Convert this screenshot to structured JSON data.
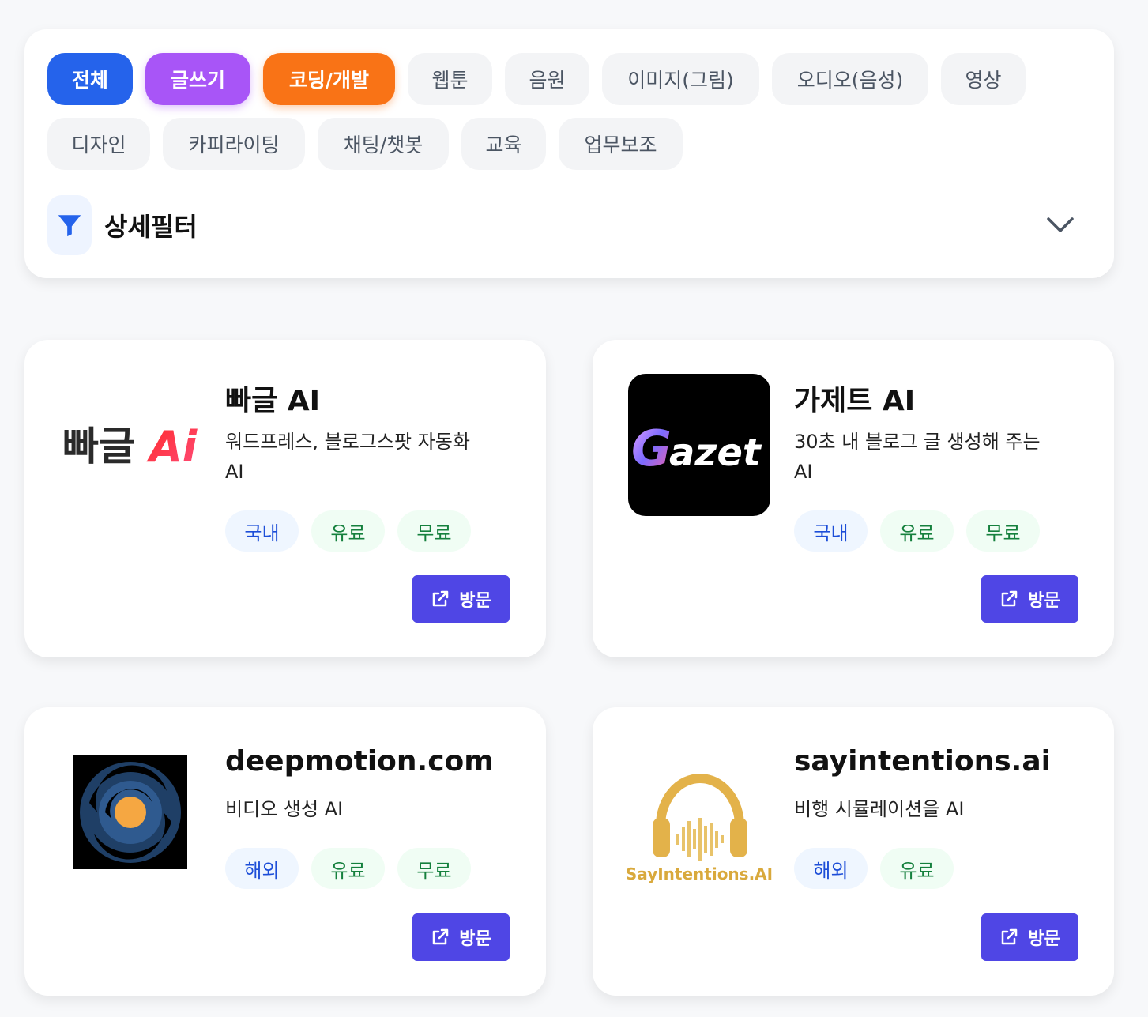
{
  "categories": {
    "row1": [
      "전체",
      "글쓰기",
      "코딩/개발",
      "웹툰",
      "음원",
      "이미지(그림)",
      "오디오(음성)",
      "영상"
    ],
    "row2": [
      "디자인",
      "카피라이팅",
      "채팅/챗봇",
      "교육",
      "업무보조"
    ]
  },
  "filter": {
    "label": "상세필터"
  },
  "cards": [
    {
      "title": "빠글 AI",
      "desc_line1": "워드프레스, 블로그스팟 자동화",
      "desc_line2": "AI",
      "logo_text_main": "빠글",
      "logo_text_ai": "Ai",
      "tags": [
        "국내",
        "유료",
        "무료"
      ],
      "visit_label": "방문"
    },
    {
      "title": "가제트 AI",
      "desc_line1": "30초 내 블로그 글 생성해 주는",
      "desc_line2": "AI",
      "logo_text_g": "G",
      "logo_text_rest": "azet",
      "tags": [
        "국내",
        "유료",
        "무료"
      ],
      "visit_label": "방문"
    },
    {
      "title": "deepmotion.com",
      "desc_line1": "비디오 생성 AI",
      "tags": [
        "해외",
        "유료",
        "무료"
      ],
      "visit_label": "방문"
    },
    {
      "title": "sayintentions.ai",
      "desc_line1": "비행 시뮬레이션을 AI",
      "logo_text": "SayIntentions.AI",
      "tags": [
        "해외",
        "유료"
      ],
      "visit_label": "방문"
    }
  ],
  "colors": {
    "accent_blue": "#2563eb",
    "accent_purple": "#a855f7",
    "accent_orange": "#f97316",
    "visit_button": "#4f46e5"
  }
}
